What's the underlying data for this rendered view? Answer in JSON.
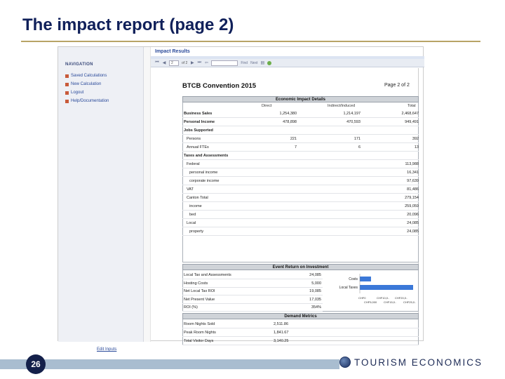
{
  "slide": {
    "title": "The impact report (page 2)",
    "page_number": "26",
    "brand": "TOURISM ECONOMICS"
  },
  "colors": {
    "title": "#10205a",
    "accent_rule": "#b8a466",
    "footer_bar": "#a9bdd0",
    "bar_blue": "#3b78d8"
  },
  "app": {
    "tab_title": "Impact Results",
    "nav": {
      "heading": "NAVIGATION",
      "items": [
        "Saved Calculations",
        "New Calculation",
        "Logout",
        "Help/Documentation"
      ]
    },
    "toolbar": {
      "page_value": "2",
      "of_label": "of 2",
      "find_label": "Find",
      "next_label": "Next"
    },
    "edit_inputs": "Edit Inputs"
  },
  "report": {
    "title": "BTCB Convention 2015",
    "page_label": "Page",
    "page_current": "2",
    "page_of": "of",
    "page_total": "2",
    "economic": {
      "heading": "Economic Impact Details",
      "columns": [
        "Direct",
        "Indirect/Induced",
        "Total"
      ],
      "rows": [
        {
          "label": "Business Sales",
          "bold": true,
          "indent": 0,
          "direct": "1,254,380",
          "indirect": "1,214,197",
          "total": "2,468,647"
        },
        {
          "label": "Personal Income",
          "bold": true,
          "indent": 0,
          "direct": "478,898",
          "indirect": "470,593",
          "total": "949,491"
        },
        {
          "label": "Jobs Supported",
          "bold": true,
          "indent": 0,
          "direct": "",
          "indirect": "",
          "total": ""
        },
        {
          "label": "Persons",
          "bold": false,
          "indent": 1,
          "direct": "221",
          "indirect": "171",
          "total": "392"
        },
        {
          "label": "Annual FTEs",
          "bold": false,
          "indent": 1,
          "direct": "7",
          "indirect": "6",
          "total": "13"
        },
        {
          "label": "Taxes and Assessments",
          "bold": true,
          "indent": 0,
          "direct": "",
          "indirect": "",
          "total": ""
        },
        {
          "label": "Federal",
          "bold": false,
          "indent": 1,
          "direct": "",
          "indirect": "",
          "total": "113,988"
        },
        {
          "label": "personal income",
          "bold": false,
          "indent": 2,
          "direct": "",
          "indirect": "",
          "total": "16,341"
        },
        {
          "label": "corporate income",
          "bold": false,
          "indent": 2,
          "direct": "",
          "indirect": "",
          "total": "97,639"
        },
        {
          "label": "VAT",
          "bold": false,
          "indent": 1,
          "direct": "",
          "indirect": "",
          "total": "81,486"
        },
        {
          "label": "Canton Total",
          "bold": false,
          "indent": 1,
          "direct": "",
          "indirect": "",
          "total": "279,154"
        },
        {
          "label": "income",
          "bold": false,
          "indent": 2,
          "direct": "",
          "indirect": "",
          "total": "259,059"
        },
        {
          "label": "bed",
          "bold": false,
          "indent": 2,
          "direct": "",
          "indirect": "",
          "total": "20,096"
        },
        {
          "label": "Local",
          "bold": false,
          "indent": 1,
          "direct": "",
          "indirect": "",
          "total": "24,085"
        },
        {
          "label": "property",
          "bold": false,
          "indent": 2,
          "direct": "",
          "indirect": "",
          "total": "24,085"
        }
      ]
    },
    "roi": {
      "heading": "Event Return on Investment",
      "rows": [
        {
          "label": "Local Tax and Assessments",
          "value": "24,085"
        },
        {
          "label": "Hosting Costs",
          "value": "5,000"
        },
        {
          "label": "Net Local Tax ROI",
          "value": "19,085"
        },
        {
          "label": "Net Present Value",
          "value": "17,035"
        },
        {
          "label": "ROI (%)",
          "value": "354%"
        }
      ],
      "chart": {
        "bars": [
          {
            "label": "Costs",
            "fraction": 0.21
          },
          {
            "label": "Local Taxes",
            "fraction": 1.0
          }
        ],
        "ticks_row1": [
          "CHF0",
          "CHF10,0..",
          "CHF20,0.."
        ],
        "ticks_row2": [
          "CHF5,000",
          "CHF15,0..",
          "CHF25,0.."
        ]
      }
    },
    "demand": {
      "heading": "Demand Metrics",
      "rows": [
        {
          "label": "Room Nights Sold",
          "value": "2,511.86"
        },
        {
          "label": "Peak Room Nights",
          "value": "1,841.67"
        },
        {
          "label": "Total Visitor Days",
          "value": "3,140.25"
        }
      ]
    }
  }
}
